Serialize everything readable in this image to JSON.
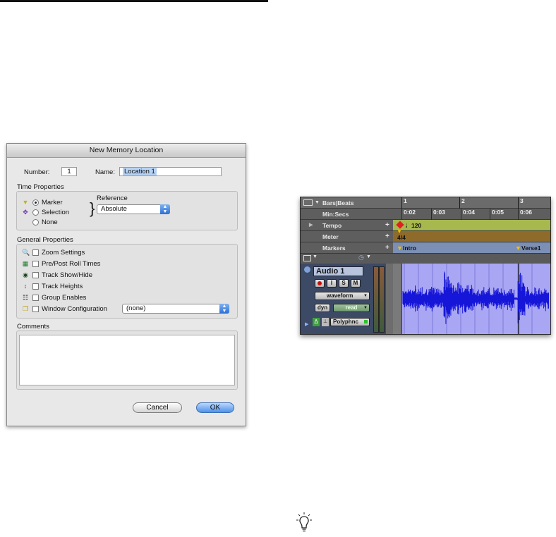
{
  "dialog": {
    "title": "New Memory Location",
    "number_label": "Number:",
    "number_value": "1",
    "name_label": "Name:",
    "name_value": "Location 1",
    "time_props_label": "Time Properties",
    "reference_label": "Reference",
    "reference_value": "Absolute",
    "radios": [
      "Marker",
      "Selection",
      "None"
    ],
    "general_label": "General Properties",
    "checks": [
      "Zoom Settings",
      "Pre/Post Roll Times",
      "Track Show/Hide",
      "Track Heights",
      "Group Enables",
      "Window Configuration"
    ],
    "window_config_value": "(none)",
    "comments_label": "Comments",
    "cancel": "Cancel",
    "ok": "OK"
  },
  "edit": {
    "ruler": "Bars|Beats",
    "bars": [
      "1",
      "2",
      "3"
    ],
    "minsecs": "Min:Secs",
    "secs": [
      "0:02",
      "0:03",
      "0:04",
      "0:05",
      "0:06"
    ],
    "tempo": "Tempo",
    "tempo_value": "120",
    "meter": "Meter",
    "meter_value": "4/4",
    "markers": "Markers",
    "marker1": "Intro",
    "marker2": "Verse1",
    "plus": "+",
    "track_name": "Audio 1",
    "i": "I",
    "s": "S",
    "m": "M",
    "view": "waveform",
    "dyn": "dyn",
    "auto": "read",
    "voice": "Polyphnc"
  },
  "colors": {
    "tempo_bg": "#a7b84f",
    "meter_bg": "#8e6a2b",
    "markers_bg": "#7c8fb4",
    "wave_bg": "#a9a6f4",
    "wave_fg": "#1616d8",
    "ok_button": "#4f92ea"
  }
}
